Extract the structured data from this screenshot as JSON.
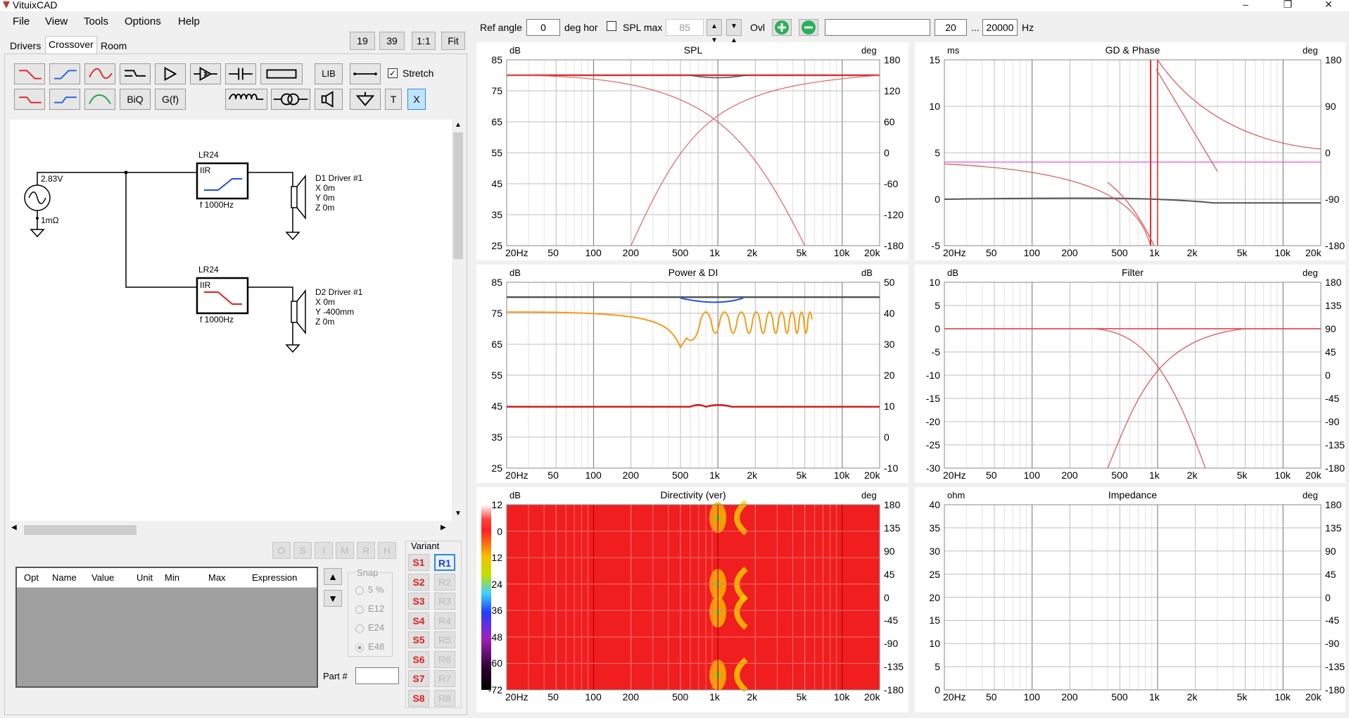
{
  "app": {
    "title": "VituixCAD"
  },
  "menu": [
    "File",
    "View",
    "Tools",
    "Options",
    "Help"
  ],
  "tabs": [
    "Drivers",
    "Crossover",
    "Room"
  ],
  "zoom_buttons": [
    "19",
    "39",
    "1:1",
    "Fit"
  ],
  "toolbar": {
    "stretch_label": "Stretch",
    "lib_label": "LIB",
    "biq_label": "BiQ",
    "gf_label": "G(f)",
    "t_label": "T",
    "x_label": "X"
  },
  "schematic": {
    "source_voltage": "2.83V",
    "source_impedance": "1mΩ",
    "filter1": {
      "name": "LR24",
      "type": "IIR",
      "freq": "f   1000Hz"
    },
    "filter2": {
      "name": "LR24",
      "type": "IIR",
      "freq": "f   1000Hz"
    },
    "driver1": [
      "D1 Driver #1",
      "X 0m",
      "Y 0m",
      "Z 0m"
    ],
    "driver2": [
      "D2 Driver #1",
      "X 0m",
      "Y -400mm",
      "Z 0m"
    ]
  },
  "opt_buttons": [
    "O",
    "S",
    "I",
    "M",
    "R",
    "H"
  ],
  "param_table": {
    "columns": [
      "Opt",
      "Name",
      "Value",
      "Unit",
      "Min",
      "Max",
      "Expression"
    ]
  },
  "snap": {
    "label": "Snap",
    "options": [
      "5 %",
      "E12",
      "E24",
      "E48"
    ],
    "selected": "E48"
  },
  "variant": {
    "label": "Variant",
    "s_buttons": [
      "S1",
      "S2",
      "S3",
      "S4",
      "S5",
      "S6",
      "S7",
      "S8"
    ],
    "r_buttons": [
      "R1",
      "R2",
      "R3",
      "R4",
      "R5",
      "R6",
      "R7",
      "R8"
    ],
    "active_r": "R1"
  },
  "part_label": "Part #",
  "top_controls": {
    "ref_angle_label": "Ref angle",
    "ref_angle_value": "0",
    "deg_hor_label": "deg hor",
    "spl_max_label": "SPL max",
    "spl_max_value": "85",
    "ovl_label": "Ovl",
    "freq_min": "20",
    "dots": "...",
    "freq_max": "20000",
    "hz_label": "Hz"
  },
  "freq_ticks": [
    "20Hz",
    "50",
    "100",
    "200",
    "500",
    "1k",
    "2k",
    "5k",
    "10k",
    "20k"
  ],
  "plots": {
    "spl": {
      "title": "SPL",
      "left_unit": "dB",
      "right_unit": "deg",
      "left_ticks": [
        "85",
        "75",
        "65",
        "55",
        "45",
        "35",
        "25"
      ],
      "right_ticks": [
        "180",
        "120",
        "60",
        "0",
        "-60",
        "-120",
        "-180"
      ]
    },
    "gd": {
      "title": "GD & Phase",
      "left_unit": "ms",
      "right_unit": "deg",
      "left_ticks": [
        "15",
        "10",
        "5",
        "0",
        "-5"
      ],
      "right_ticks": [
        "180",
        "90",
        "0",
        "-90",
        "-180"
      ]
    },
    "power": {
      "title": "Power & DI",
      "left_unit": "dB",
      "right_unit": "dB",
      "left_ticks": [
        "85",
        "75",
        "65",
        "55",
        "45",
        "35",
        "25"
      ],
      "right_ticks": [
        "50",
        "40",
        "30",
        "20",
        "10",
        "0",
        "-10"
      ]
    },
    "filter": {
      "title": "Filter",
      "left_unit": "dB",
      "right_unit": "deg",
      "left_ticks": [
        "10",
        "5",
        "0",
        "-5",
        "-10",
        "-15",
        "-20",
        "-25",
        "-30"
      ],
      "right_ticks": [
        "180",
        "135",
        "90",
        "45",
        "0",
        "-45",
        "-90",
        "-135",
        "-180"
      ]
    },
    "directivity": {
      "title": "Directivity (ver)",
      "left_unit": "dB",
      "right_unit": "deg",
      "scale_ticks": [
        "12",
        "0",
        "-12",
        "-24",
        "-36",
        "-48",
        "-60",
        "-72"
      ],
      "right_ticks": [
        "180",
        "135",
        "90",
        "45",
        "0",
        "-45",
        "-90",
        "-135",
        "-180"
      ]
    },
    "impedance": {
      "title": "Impedance",
      "left_unit": "ohm",
      "right_unit": "deg",
      "left_ticks": [
        "40",
        "35",
        "30",
        "25",
        "20",
        "15",
        "10",
        "5",
        "0"
      ],
      "right_ticks": [
        "180",
        "135",
        "90",
        "45",
        "0",
        "-45",
        "-90",
        "-135",
        "-180"
      ]
    }
  }
}
